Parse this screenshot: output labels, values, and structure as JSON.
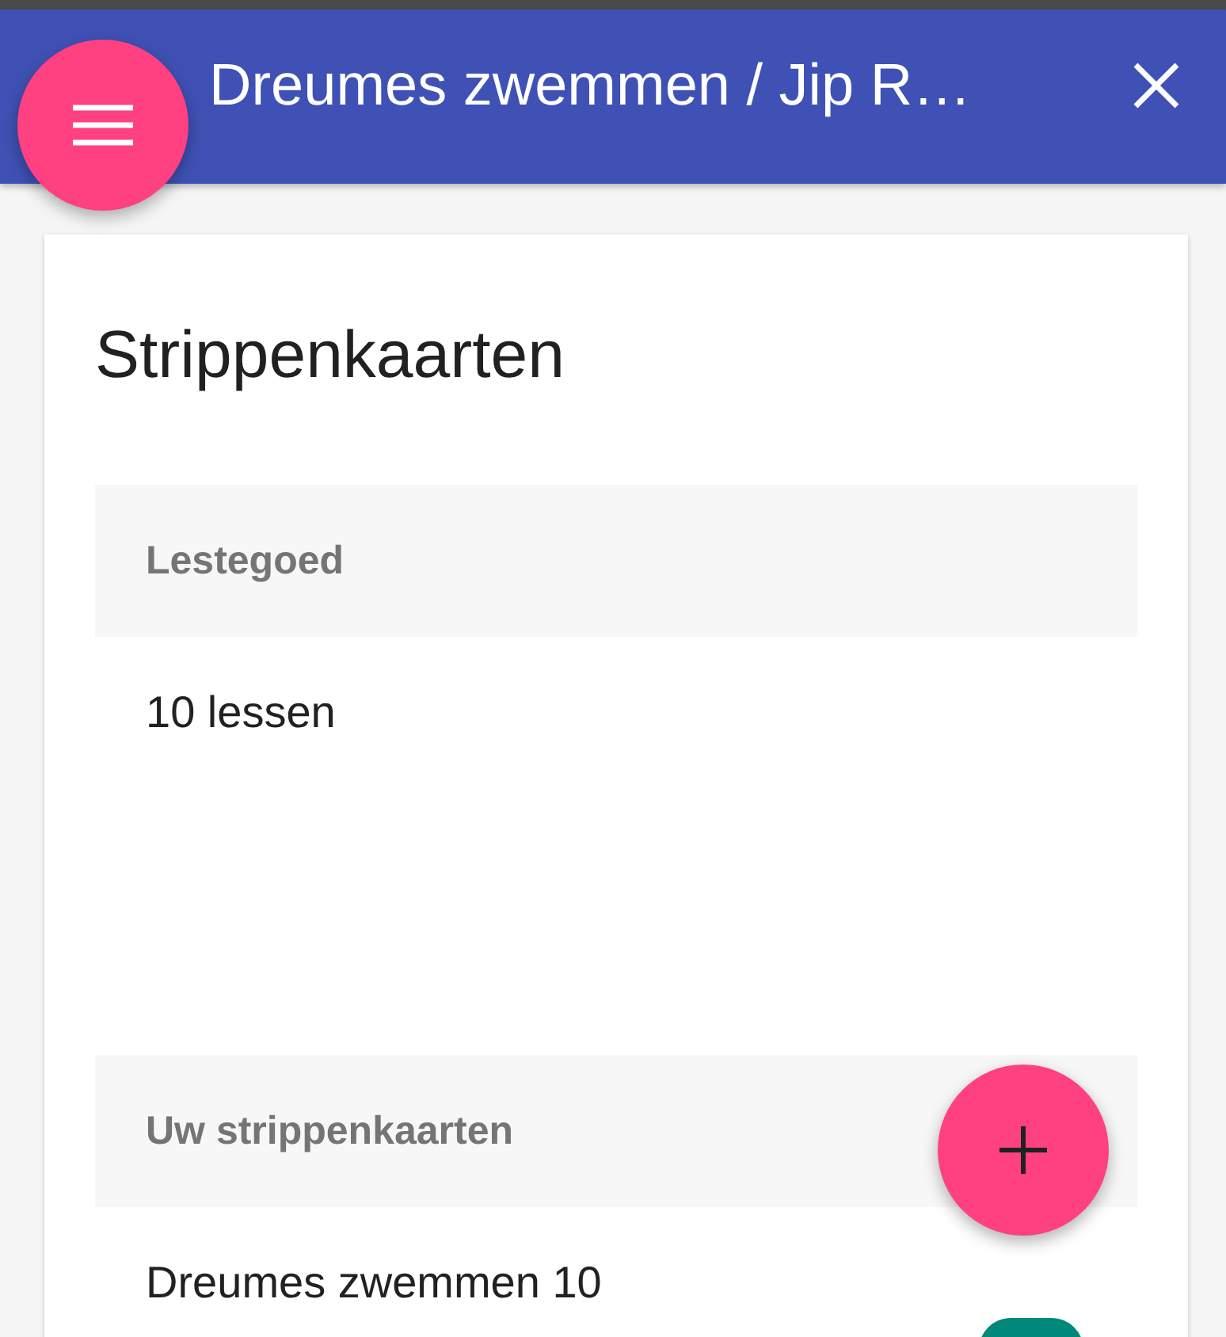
{
  "app_bar": {
    "title": "Dreumes zwemmen / Jip R…"
  },
  "card": {
    "title": "Strippenkaarten",
    "sections": [
      {
        "header": "Lestegoed",
        "items": [
          {
            "text": "10 lessen"
          }
        ]
      },
      {
        "header": "Uw strippenkaarten",
        "items": [
          {
            "text": "Dreumes zwemmen 10"
          }
        ]
      }
    ]
  }
}
